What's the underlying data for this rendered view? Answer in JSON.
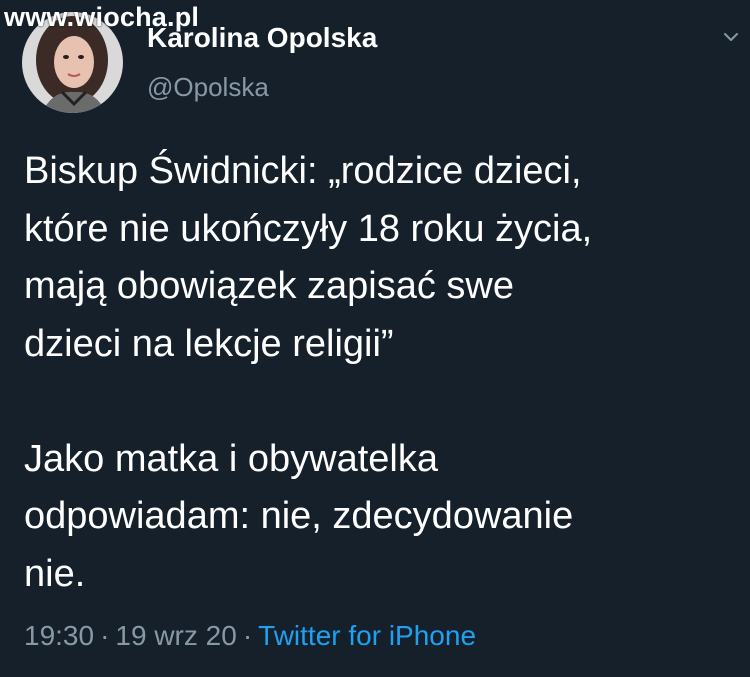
{
  "watermark": "www.wiocha.pl",
  "author": {
    "display_name": "Karolina Opolska",
    "handle": "@Opolska"
  },
  "icons": {
    "avatar": "profile-photo",
    "menu": "chevron-down-icon"
  },
  "tweet": {
    "lines": [
      "Biskup Świdnicki: „rodzice dzieci,",
      "które nie ukończyły 18 roku życia,",
      "mają obowiązek zapisać swe",
      "dzieci na lekcje religii”",
      "Jako matka i obywatelka",
      "odpowiadam: nie, zdecydowanie",
      "nie."
    ]
  },
  "meta": {
    "time": "19:30",
    "separator": "·",
    "date": "19 wrz 20",
    "source": "Twitter for iPhone"
  },
  "colors": {
    "background": "#15202b",
    "primary_text": "#ffffff",
    "secondary_text": "#8899a6",
    "link": "#1da1f2"
  }
}
